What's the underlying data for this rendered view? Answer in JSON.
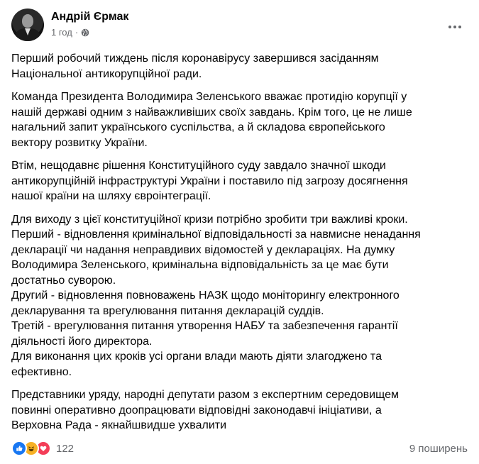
{
  "post": {
    "author": "Андрій Єрмак",
    "time": "1 год",
    "separator": "·",
    "audience_icon": "globe-icon",
    "more_icon": "more-options-icon",
    "paragraphs": [
      "Перший робочий тиждень після коронавірусу завершився засіданням\nНаціональної антикорупційної ради.",
      "Команда Президента Володимира Зеленського вважає протидію корупції у\nнашій державі одним з найважливіших своїх завдань. Крім того, це не лише\nнагальний запит українського суспільства, а й складова європейського\nвектору розвитку України.",
      "Втім, нещодавнє рішення Конституційного суду завдало значної шкоди\nантикорупційній інфраструктурі України і поставило під загрозу досягнення\nнашої країни на шляху євроінтеграції.",
      "Для виходу з цієї конституційної кризи потрібно зробити три важливі кроки.\nПерший - відновлення кримінальної відповідальності за навмисне ненадання\nдекларації чи надання  неправдивих відомостей у деклараціях. На думку\nВолодимира Зеленського, кримінальна відповідальність  за це  має бути\nдостатньо суворою.\nДругий - відновлення повноважень НАЗК щодо моніторингу електронного\nдекларування та врегулювання питання декларацій суддів.\nТретій - врегулювання питання утворення НАБУ та забезпечення гарантії\nдіяльності його директора.\nДля виконання цих кроків  усі органи влади мають діяти злагоджено та\nефективно.",
      "Представники уряду, народні депутати разом з експертним середовищем\nповинні оперативно доопрацювати  відповідні законодавчі ініціативи, а\nВерховна Рада - якнайшвидше ухвалити"
    ]
  },
  "footer": {
    "reaction_icons": [
      "like-icon",
      "haha-icon",
      "love-icon"
    ],
    "reaction_count": "122",
    "shares": "9 поширень"
  },
  "colors": {
    "like": "#1877f2",
    "haha": "#f7b125",
    "love": "#f33e58",
    "secondary_text": "#65676b"
  }
}
